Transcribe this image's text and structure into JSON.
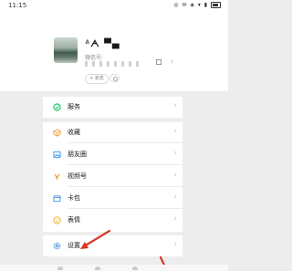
{
  "status_bar": {
    "time": "11:15",
    "icons": "◎ ✉ ◈ ▾ ▮"
  },
  "profile": {
    "nickname": "ᐞᗅ ▀▄",
    "wechat_id_label": "微信号:",
    "status_button": "+ 状态"
  },
  "menu": {
    "services": {
      "label": "服务",
      "icon": "services-icon",
      "color": "#07c160"
    },
    "items": [
      {
        "label": "收藏",
        "icon": "favorites-icon",
        "color": "#f2a23a"
      },
      {
        "label": "朋友圈",
        "icon": "moments-icon",
        "color": "#2b8ff2"
      },
      {
        "label": "视频号",
        "icon": "channels-icon",
        "color": "#f28c28"
      },
      {
        "label": "卡包",
        "icon": "card-wallet-icon",
        "color": "#3b8bdf"
      },
      {
        "label": "表情",
        "icon": "stickers-icon",
        "color": "#f0b422"
      }
    ],
    "settings": {
      "label": "设置",
      "icon": "settings-icon",
      "color": "#3b8bdf"
    }
  },
  "annotation_color": "#d9362b"
}
